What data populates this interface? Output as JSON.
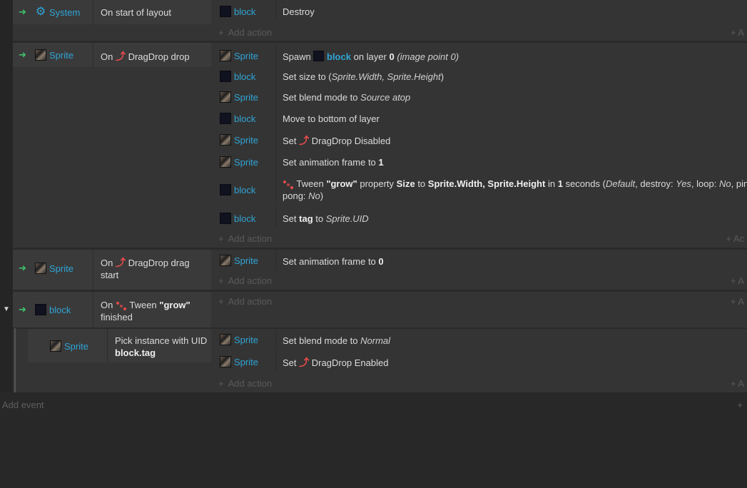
{
  "events": [
    {
      "object": "System",
      "condition": "On start of layout",
      "actions": [
        {
          "object": "block",
          "text": "Destroy"
        }
      ]
    },
    {
      "object": "Sprite",
      "condition": "On",
      "condition_behavior": "DragDrop drop",
      "actions": [
        {
          "object": "Sprite",
          "parts": [
            "Spawn",
            "block",
            "on layer",
            "0",
            "(image point 0)"
          ]
        },
        {
          "object": "block",
          "parts": [
            "Set size to (",
            "Sprite.Width, Sprite.Height",
            ")"
          ]
        },
        {
          "object": "Sprite",
          "parts": [
            "Set blend mode to",
            "Source atop"
          ]
        },
        {
          "object": "block",
          "text": "Move to bottom of layer"
        },
        {
          "object": "Sprite",
          "parts": [
            "Set",
            "DragDrop Disabled"
          ]
        },
        {
          "object": "Sprite",
          "parts": [
            "Set animation frame to",
            "1"
          ]
        },
        {
          "object": "block",
          "parts": [
            "Tween",
            "\"grow\"",
            "property",
            "Size",
            "to",
            "Sprite.Width, Sprite.Height",
            "in",
            "1",
            "seconds (",
            "Default",
            ", destroy:",
            "Yes",
            ", loop:",
            "No",
            ", ping-",
            "pong:",
            "No",
            ")"
          ]
        },
        {
          "object": "block",
          "parts": [
            "Set",
            "tag",
            "to",
            "Sprite.UID"
          ]
        }
      ]
    },
    {
      "object": "Sprite",
      "condition": "On",
      "condition_behavior": "DragDrop drag",
      "condition_line2": "start",
      "actions": [
        {
          "object": "Sprite",
          "parts": [
            "Set animation frame to",
            "0"
          ]
        }
      ]
    },
    {
      "object": "block",
      "condition": "On",
      "condition_behavior": "Tween",
      "condition_bold": "\"grow\"",
      "condition_line2": "finished",
      "actions": []
    },
    {
      "object": "Sprite",
      "condition": "Pick instance with UID",
      "condition_line2": "block.tag",
      "actions": [
        {
          "object": "Sprite",
          "parts": [
            "Set blend mode to",
            "Normal"
          ]
        },
        {
          "object": "Sprite",
          "parts": [
            "Set",
            "DragDrop Enabled"
          ]
        }
      ]
    }
  ],
  "labels": {
    "add_action": "Add action",
    "add_event": "Add event",
    "plus": "+",
    "arrow": "➜"
  },
  "colors": {
    "accent": "#2fa5d6",
    "arrow": "#3fc36b",
    "behavior_icon": "#ec4b4b",
    "background": "#343434"
  }
}
